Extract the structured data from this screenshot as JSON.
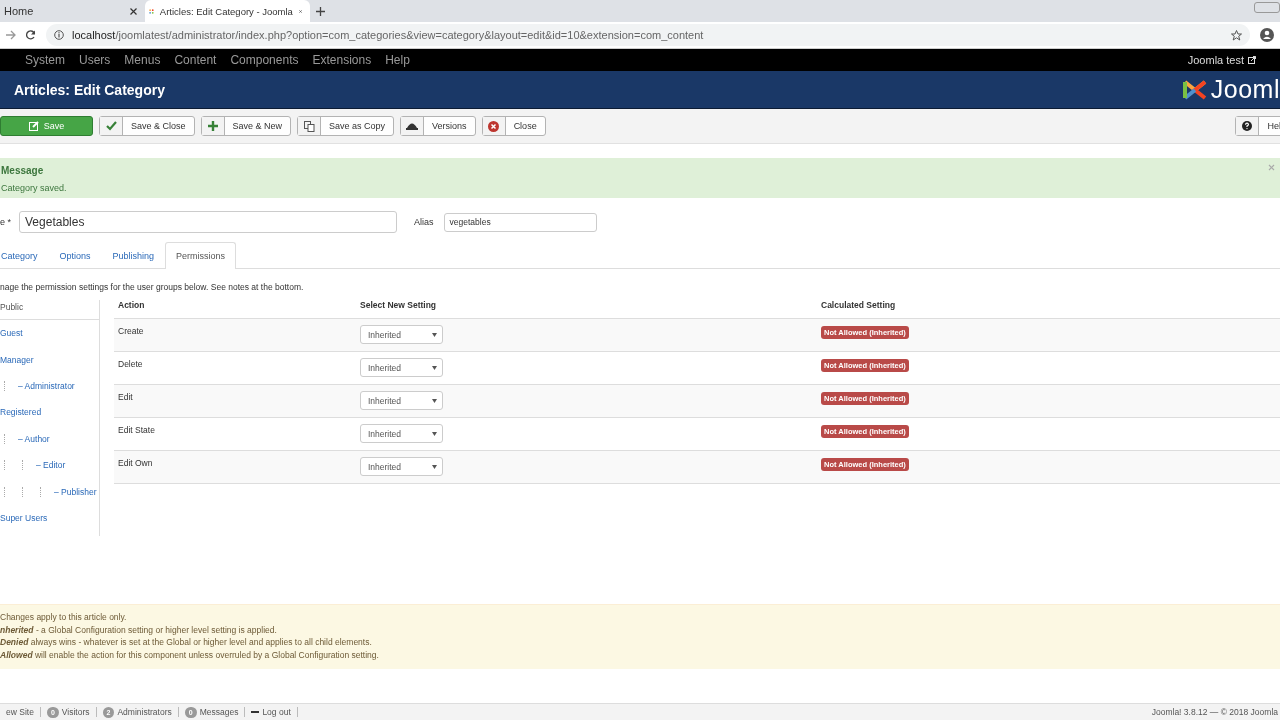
{
  "browser": {
    "tabs": [
      {
        "title": "Home",
        "selected": false
      },
      {
        "title": "Articles: Edit Category - Joomla",
        "selected": true
      }
    ],
    "url_host": "localhost",
    "url_path": "/joomlatest/administrator/index.php?option=com_categories&view=category&layout=edit&id=10&extension=com_content"
  },
  "menu_bar": {
    "items": [
      "System",
      "Users",
      "Menus",
      "Content",
      "Components",
      "Extensions",
      "Help"
    ],
    "site_link": "Joomla test"
  },
  "header": {
    "title": "Articles: Edit Category",
    "logo_text": "Jooml"
  },
  "toolbar": {
    "buttons": [
      {
        "label": "Save",
        "kind": "primary"
      },
      {
        "label": "Save & Close",
        "kind": "check"
      },
      {
        "label": "Save & New",
        "kind": "plus"
      },
      {
        "label": "Save as Copy",
        "kind": "copy"
      },
      {
        "label": "Versions",
        "kind": "versions"
      },
      {
        "label": "Close",
        "kind": "close"
      }
    ],
    "help": "Hel"
  },
  "message": {
    "heading": "Message",
    "text": "Category saved."
  },
  "form": {
    "title_label": "e *",
    "title_value": "Vegetables",
    "alias_label": "Alias",
    "alias_value": "vegetables"
  },
  "tabs": [
    {
      "label": "Category",
      "selected": false
    },
    {
      "label": "Options",
      "selected": false
    },
    {
      "label": "Publishing",
      "selected": false
    },
    {
      "label": "Permissions",
      "selected": true
    }
  ],
  "description": "nage the permission settings for the user groups below. See notes at the bottom.",
  "groups": [
    {
      "label": "Public",
      "selected": true,
      "children": [
        {
          "label": "Guest",
          "selected": false
        },
        {
          "label": "Manager",
          "selected": false,
          "children": [
            {
              "label": "– Administrator",
              "selected": false
            }
          ]
        },
        {
          "label": "Registered",
          "selected": false,
          "children": [
            {
              "label": "– Author",
              "selected": false,
              "children": [
                {
                  "label": "– Editor",
                  "selected": false,
                  "children": [
                    {
                      "label": "– Publisher",
                      "selected": false
                    }
                  ]
                }
              ]
            }
          ]
        },
        {
          "label": "Super Users",
          "selected": false
        }
      ]
    }
  ],
  "table": {
    "columns": [
      "Action",
      "Select New Setting",
      "Calculated Setting"
    ],
    "rows": [
      {
        "action": "Create",
        "setting": "Inherited",
        "calculated": "Not Allowed (Inherited)"
      },
      {
        "action": "Delete",
        "setting": "Inherited",
        "calculated": "Not Allowed (Inherited)"
      },
      {
        "action": "Edit",
        "setting": "Inherited",
        "calculated": "Not Allowed (Inherited)"
      },
      {
        "action": "Edit State",
        "setting": "Inherited",
        "calculated": "Not Allowed (Inherited)"
      },
      {
        "action": "Edit Own",
        "setting": "Inherited",
        "calculated": "Not Allowed (Inherited)"
      }
    ]
  },
  "notes": [
    "Changes apply to this article only.",
    "**nherited** - a Global Configuration setting or higher level setting is applied.",
    "**Denied** always wins - whatever is set at the Global or higher level and applies to all child elements.",
    "**Allowed** will enable the action for this component unless overruled by a Global Configuration setting."
  ],
  "status_bar": {
    "items": [
      {
        "label": "ew Site"
      },
      {
        "count": "0",
        "label": "Visitors"
      },
      {
        "count": "2",
        "label": "Administrators"
      },
      {
        "count": "0",
        "label": "Messages"
      },
      {
        "label": "Log out",
        "kind": "logout"
      }
    ],
    "version": "Joomla! 3.8.12 — © 2018 Joomla"
  }
}
